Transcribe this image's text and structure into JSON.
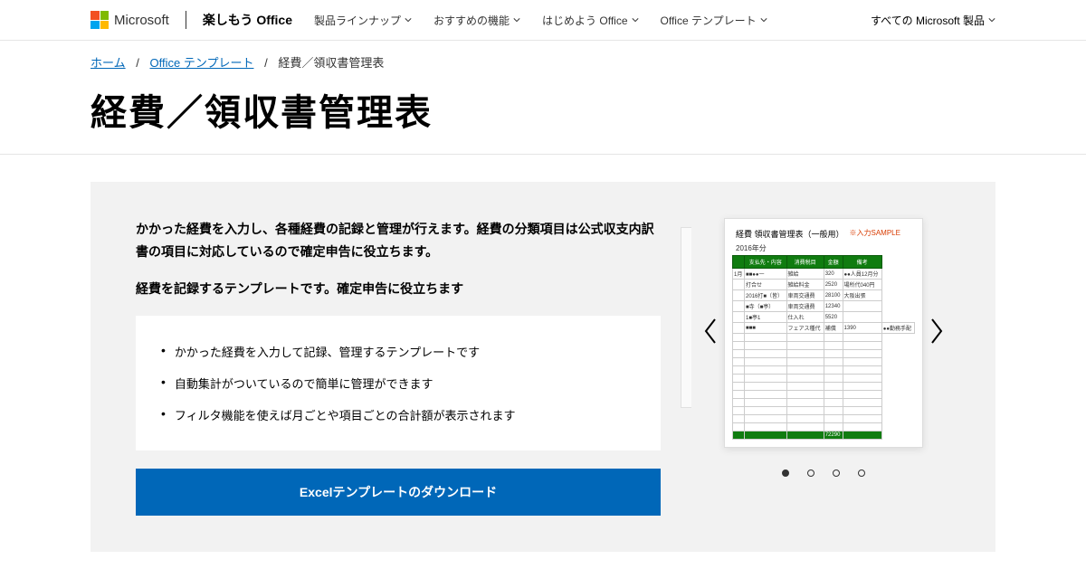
{
  "header": {
    "brand": "Microsoft",
    "site_title": "楽しもう Office",
    "nav": [
      {
        "label": "製品ラインナップ"
      },
      {
        "label": "おすすめの機能"
      },
      {
        "label": "はじめよう Office"
      },
      {
        "label": "Office テンプレート"
      }
    ],
    "right_label": "すべての Microsoft 製品"
  },
  "breadcrumb": {
    "home": "ホーム",
    "templates": "Office テンプレート",
    "current": "経費／領収書管理表"
  },
  "title": "経費／領収書管理表",
  "description": {
    "main": "かかった経費を入力し、各種経費の記録と管理が行えます。経費の分類項目は公式収支内訳書の項目に対応しているので確定申告に役立ちます。",
    "sub": "経費を記録するテンプレートです。確定申告に役立ちます"
  },
  "bullets": [
    "かかった経費を入力して記録、管理するテンプレートです",
    "自動集計がついているので簡単に管理ができます",
    "フィルタ機能を使えば月ごとや項目ごとの合計額が表示されます"
  ],
  "download_label": "Excelテンプレートのダウンロード",
  "preview": {
    "title": "経費 領収書管理表（一般用）",
    "sample_mark": "※入力SAMPLE",
    "year": "2016年分",
    "table_headers": [
      "",
      "支払先・内容",
      "消費税目",
      "金額",
      "備考"
    ],
    "rows": [
      [
        "1月",
        "■■●●一",
        "雑給",
        "320",
        "●●人員12月分"
      ],
      [
        "",
        "打合せ",
        "雑給料金",
        "2520",
        "場所代040円"
      ],
      [
        "",
        "2016打■（皆）",
        "車両交通費",
        "28100",
        "大阪出張"
      ],
      [
        "",
        "■寺（■亭）",
        "車両交通費",
        "12340",
        ""
      ],
      [
        "",
        "1■亭1",
        "仕入れ",
        "5520",
        ""
      ],
      [
        "",
        "■■■",
        "フェアス種代",
        "補償",
        "1390",
        "●●勤務手配"
      ]
    ],
    "total": "72290"
  },
  "carousel": {
    "active_dot": 0,
    "total_dots": 4
  }
}
